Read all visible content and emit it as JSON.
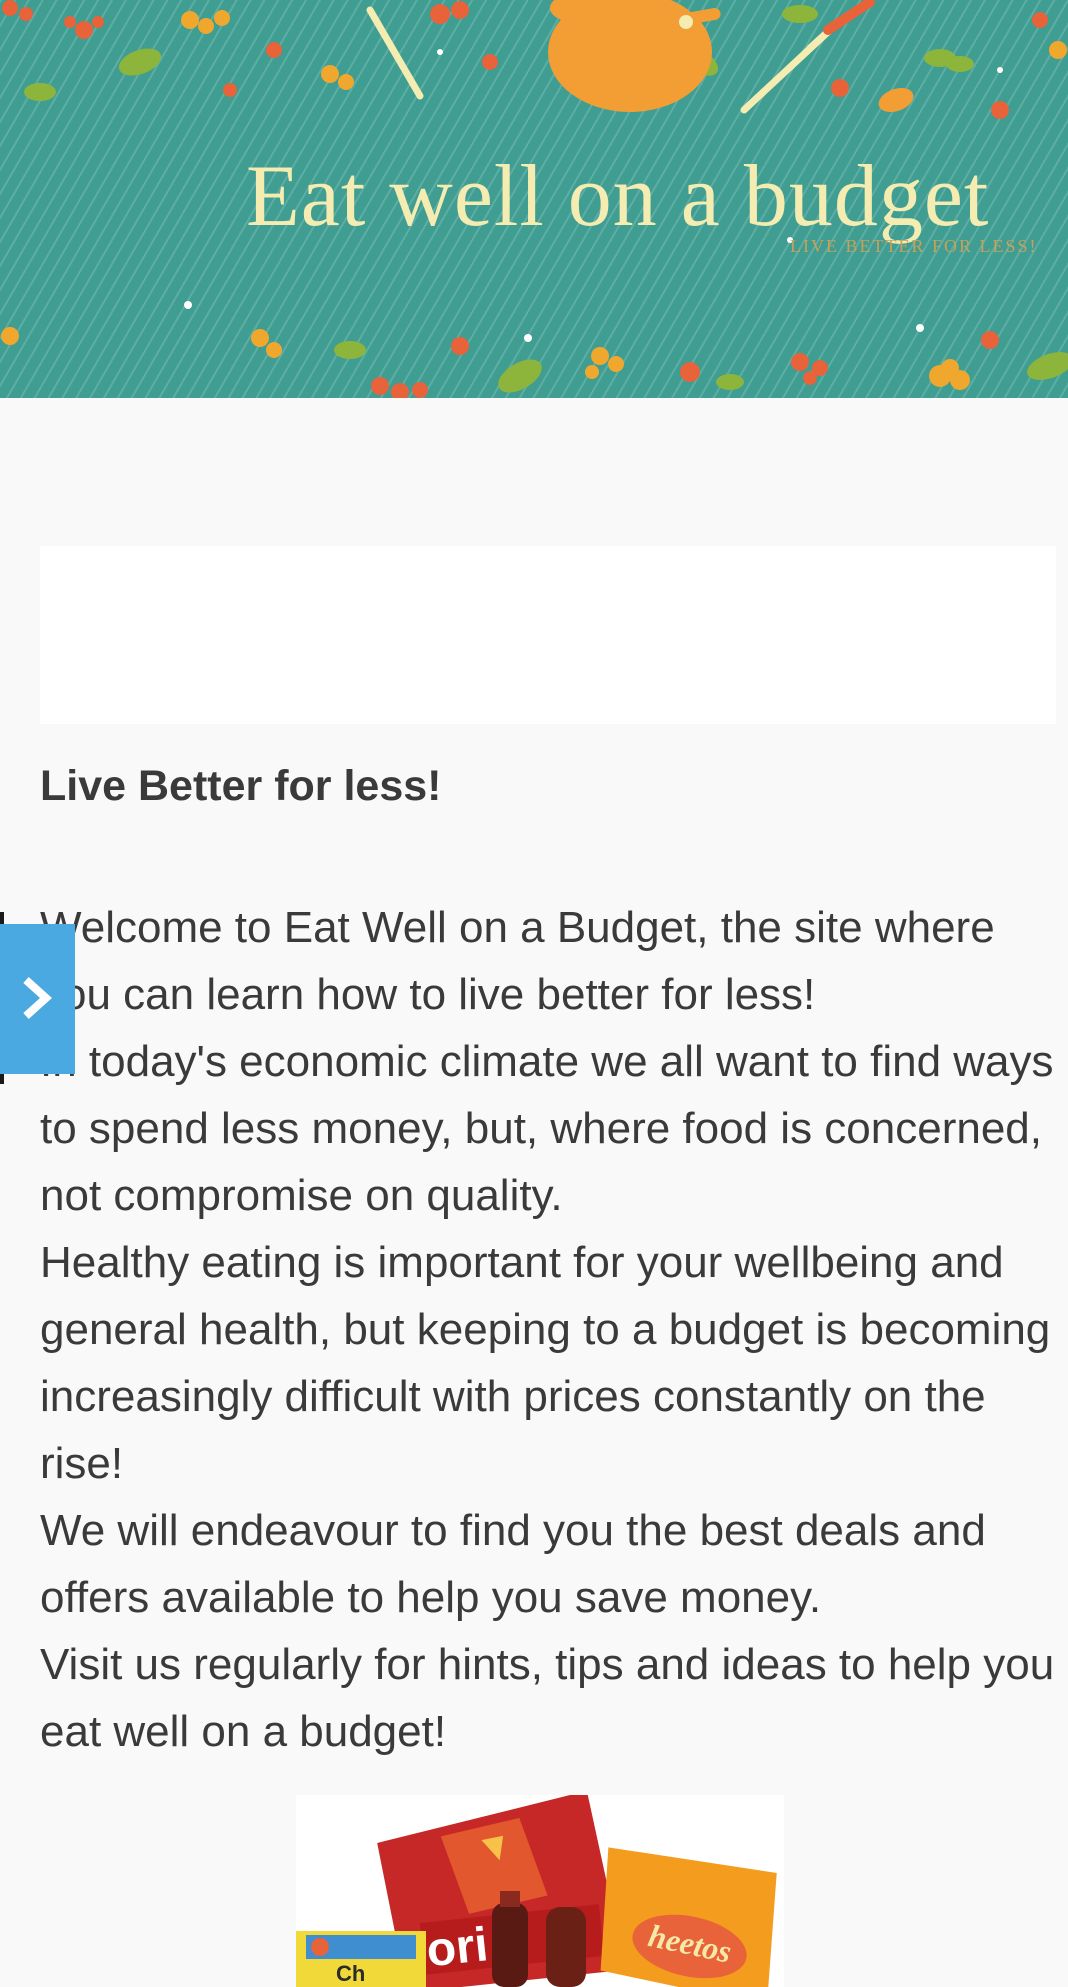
{
  "header": {
    "title": "Eat well  on a budget",
    "tagline": "LIVE BETTER FOR LESS!",
    "colors": {
      "background": "#3f9d92",
      "title": "#f4ecb0"
    }
  },
  "post": {
    "heading": "Live Better for less!",
    "paragraphs": [
      "Welcome to Eat Well on a Budget, the site where you can learn how to live better for less!",
      "In today's economic climate we all want to find ways to spend less money, but, where food is concerned, not compromise on quality.",
      "Healthy eating is important for your wellbeing and general health, but keeping to a budget is becoming increasingly difficult with prices constantly on the rise!",
      "We will endeavour to find you the best deals and offers available to help you save money.",
      "Visit us regularly for hints, tips and ideas to help you eat well on a budget!"
    ]
  },
  "sidebar_toggle": {
    "icon": "chevron-right-icon",
    "color": "#4aa9e0"
  },
  "product_image": {
    "brands": [
      "Doritos",
      "Cheetos"
    ]
  }
}
